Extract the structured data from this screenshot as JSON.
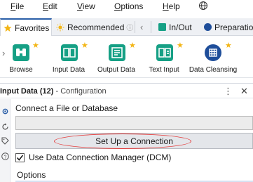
{
  "menu": {
    "items": [
      {
        "label": "File",
        "accel": "F",
        "rest": "ile"
      },
      {
        "label": "Edit",
        "accel": "E",
        "rest": "dit"
      },
      {
        "label": "View",
        "accel": "V",
        "rest": "iew"
      },
      {
        "label": "Options",
        "accel": "O",
        "rest": "ptions"
      },
      {
        "label": "Help",
        "accel": "H",
        "rest": "elp"
      }
    ],
    "globe_icon": "globe-icon"
  },
  "tabs": {
    "favorites": "Favorites",
    "recommended": "Recommended",
    "in_out": "In/Out",
    "preparation": "Preparatio"
  },
  "tools": [
    {
      "label": "Browse",
      "icon": "binoculars-icon",
      "color": "#16a085"
    },
    {
      "label": "Input Data",
      "icon": "book-icon",
      "color": "#16a085"
    },
    {
      "label": "Output Data",
      "icon": "output-book-icon",
      "color": "#16a085"
    },
    {
      "label": "Text Input",
      "icon": "book-icon",
      "color": "#16a085"
    },
    {
      "label": "Data Cleansing",
      "icon": "cleanse-icon",
      "color": "#1f4e9a"
    }
  ],
  "config": {
    "tool_name": "Input Data (12)",
    "subtitle": "- Configuration",
    "connect_label": "Connect a File or Database",
    "file_value": "",
    "setup_button": "Set Up a Connection",
    "dcm_label": "Use Data Connection Manager (DCM)",
    "dcm_checked": true,
    "options_label": "Options"
  },
  "colors": {
    "accent_blue": "#2b5fa8",
    "star": "#f3b515",
    "highlight_ring": "#e43b3b"
  }
}
